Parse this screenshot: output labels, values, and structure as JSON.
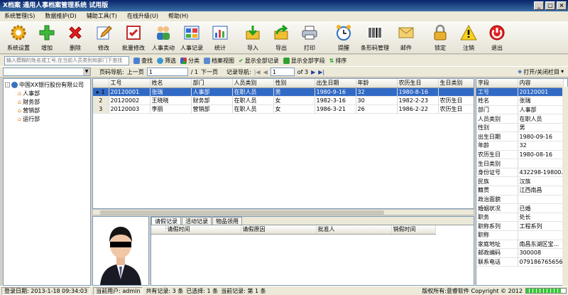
{
  "window": {
    "title": "X档案  通用人事档案管理系统  试用版"
  },
  "menu": [
    "系统管理(S)",
    "数据维护(D)",
    "辅助工具(T)",
    "在线升级(U)",
    "帮助(H)"
  ],
  "toolbar": [
    {
      "label": "系统设置",
      "icon": "gear-icon"
    },
    {
      "label": "增加",
      "icon": "add-icon"
    },
    {
      "label": "删除",
      "icon": "delete-icon"
    },
    {
      "label": "修改",
      "icon": "edit-icon"
    },
    {
      "label": "批量修改",
      "icon": "batch-edit-icon"
    },
    {
      "label": "人事卖动",
      "icon": "people-icon"
    },
    {
      "label": "人事记录",
      "icon": "record-icon"
    },
    {
      "label": "统计",
      "icon": "chart-icon"
    },
    {
      "label": "导入",
      "icon": "import-icon"
    },
    {
      "label": "导出",
      "icon": "export-icon"
    },
    {
      "label": "打印",
      "icon": "printer-icon"
    },
    {
      "label": "提醒",
      "icon": "alarm-clock-icon"
    },
    {
      "label": "条形码管理",
      "icon": "barcode-icon"
    },
    {
      "label": "邮件",
      "icon": "mail-icon"
    },
    {
      "label": "锁定",
      "icon": "lock-icon"
    },
    {
      "label": "注销",
      "icon": "warning-icon"
    },
    {
      "label": "退出",
      "icon": "exit-icon"
    }
  ],
  "search": {
    "placeholder": "输入模糊的姓名或工号,在当前人员类别和部门下查找",
    "buttons": [
      "查找",
      "筛选",
      "分类",
      "档案视图",
      "显示全部记录",
      "显示全部字段",
      "排序"
    ]
  },
  "nav": {
    "page_label": "页码导航:",
    "prev_page": "上一页",
    "page_value": "1",
    "page_total": "/ 1",
    "next_page": "下一页",
    "record_label": "记录导航:",
    "record_value": "1",
    "record_total": "of 3",
    "toggle_columns": "打开/关闭栏目"
  },
  "tree": {
    "root": "中国XX银行股份有限公司",
    "children": [
      "人事部",
      "财务部",
      "营销部",
      "运行部"
    ]
  },
  "grid": {
    "columns": [
      "工号",
      "姓名",
      "部门",
      "人员类别",
      "性别",
      "出生日期",
      "年龄",
      "农历生日",
      "生日类别"
    ],
    "rows": [
      [
        "1",
        "20120001",
        "张瑞",
        "人事部",
        "在职人员",
        "男",
        "1980-9-16",
        "32",
        "1980-8-16",
        ""
      ],
      [
        "2",
        "20120002",
        "王晓晓",
        "财务部",
        "在职人员",
        "女",
        "1982-3-16",
        "30",
        "1982-2-23",
        "农历生日"
      ],
      [
        "3",
        "20120003",
        "李丽",
        "营销部",
        "在职人员",
        "女",
        "1986-3-21",
        "26",
        "1986-2-22",
        "农历生日"
      ]
    ]
  },
  "subtabs": {
    "tabs": [
      "请假记录",
      "活动记录",
      "物品领用"
    ],
    "columns": [
      "请假时间",
      "请假原因",
      "批准人",
      "销假时间"
    ]
  },
  "detail": {
    "headers": [
      "字段",
      "内容"
    ],
    "rows": [
      [
        "工号",
        "20120001"
      ],
      [
        "姓名",
        "张瑞"
      ],
      [
        "部门",
        "人事部"
      ],
      [
        "人员类别",
        "在职人员"
      ],
      [
        "性别",
        "男"
      ],
      [
        "出生日期",
        "1980-09-16"
      ],
      [
        "年龄",
        "32"
      ],
      [
        "农历生日",
        "1980-08-16"
      ],
      [
        "生日类别",
        ""
      ],
      [
        "身份证号",
        "432298-19800..."
      ],
      [
        "民族",
        "汉族"
      ],
      [
        "籍贯",
        "江西南昌"
      ],
      [
        "政治面貌",
        ""
      ],
      [
        "婚姻状况",
        "已婚"
      ],
      [
        "职务",
        "处长"
      ],
      [
        "职称系列",
        "工程系列"
      ],
      [
        "职称",
        ""
      ],
      [
        "家庭地址",
        "南昌东湖区宝..."
      ],
      [
        "邮政编码",
        "300008"
      ],
      [
        "联系电话",
        "079186765656"
      ]
    ]
  },
  "status": {
    "login_date": "登录日期: 2013-1-18 09:34:03",
    "current_user": "当前用户: admin",
    "total": "共有记录: 3 条",
    "selected": "已选择: 1 条",
    "current_record": "当前记录: 第 1 条",
    "copyright": "版权所有:意睿软件 Copyright © 2012",
    "progress": 0.9
  }
}
